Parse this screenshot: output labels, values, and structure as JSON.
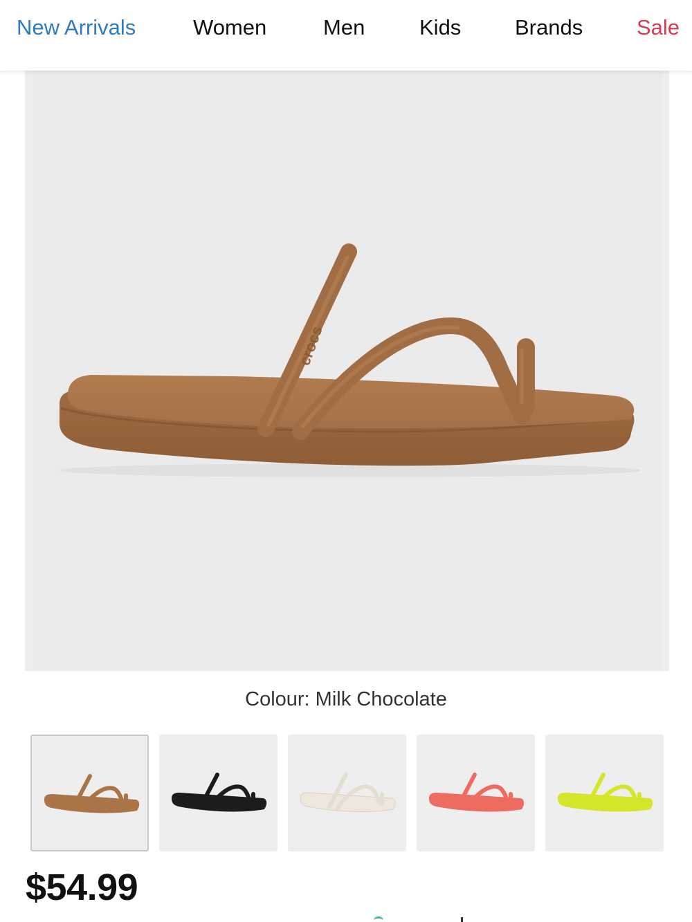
{
  "nav": {
    "items": [
      {
        "label": "New Arrivals"
      },
      {
        "label": "Women"
      },
      {
        "label": "Men"
      },
      {
        "label": "Kids"
      },
      {
        "label": "Brands"
      },
      {
        "label": "Sale"
      }
    ]
  },
  "hero": {
    "logo_text": "crocs"
  },
  "product": {
    "colour_label": "Colour: Milk Chocolate",
    "price": "$54.99"
  },
  "swatches": [
    {
      "color": "#a87448",
      "selected": true
    },
    {
      "color": "#1c1c1c",
      "selected": false
    },
    {
      "color": "#ede7dc",
      "selected": false
    },
    {
      "color": "#ee6b62",
      "selected": false
    },
    {
      "color": "#d5e62a",
      "selected": false
    }
  ],
  "colors": {
    "accent": "#2f7bbf",
    "sale": "#d63a55",
    "sandal": "#a8754a"
  }
}
